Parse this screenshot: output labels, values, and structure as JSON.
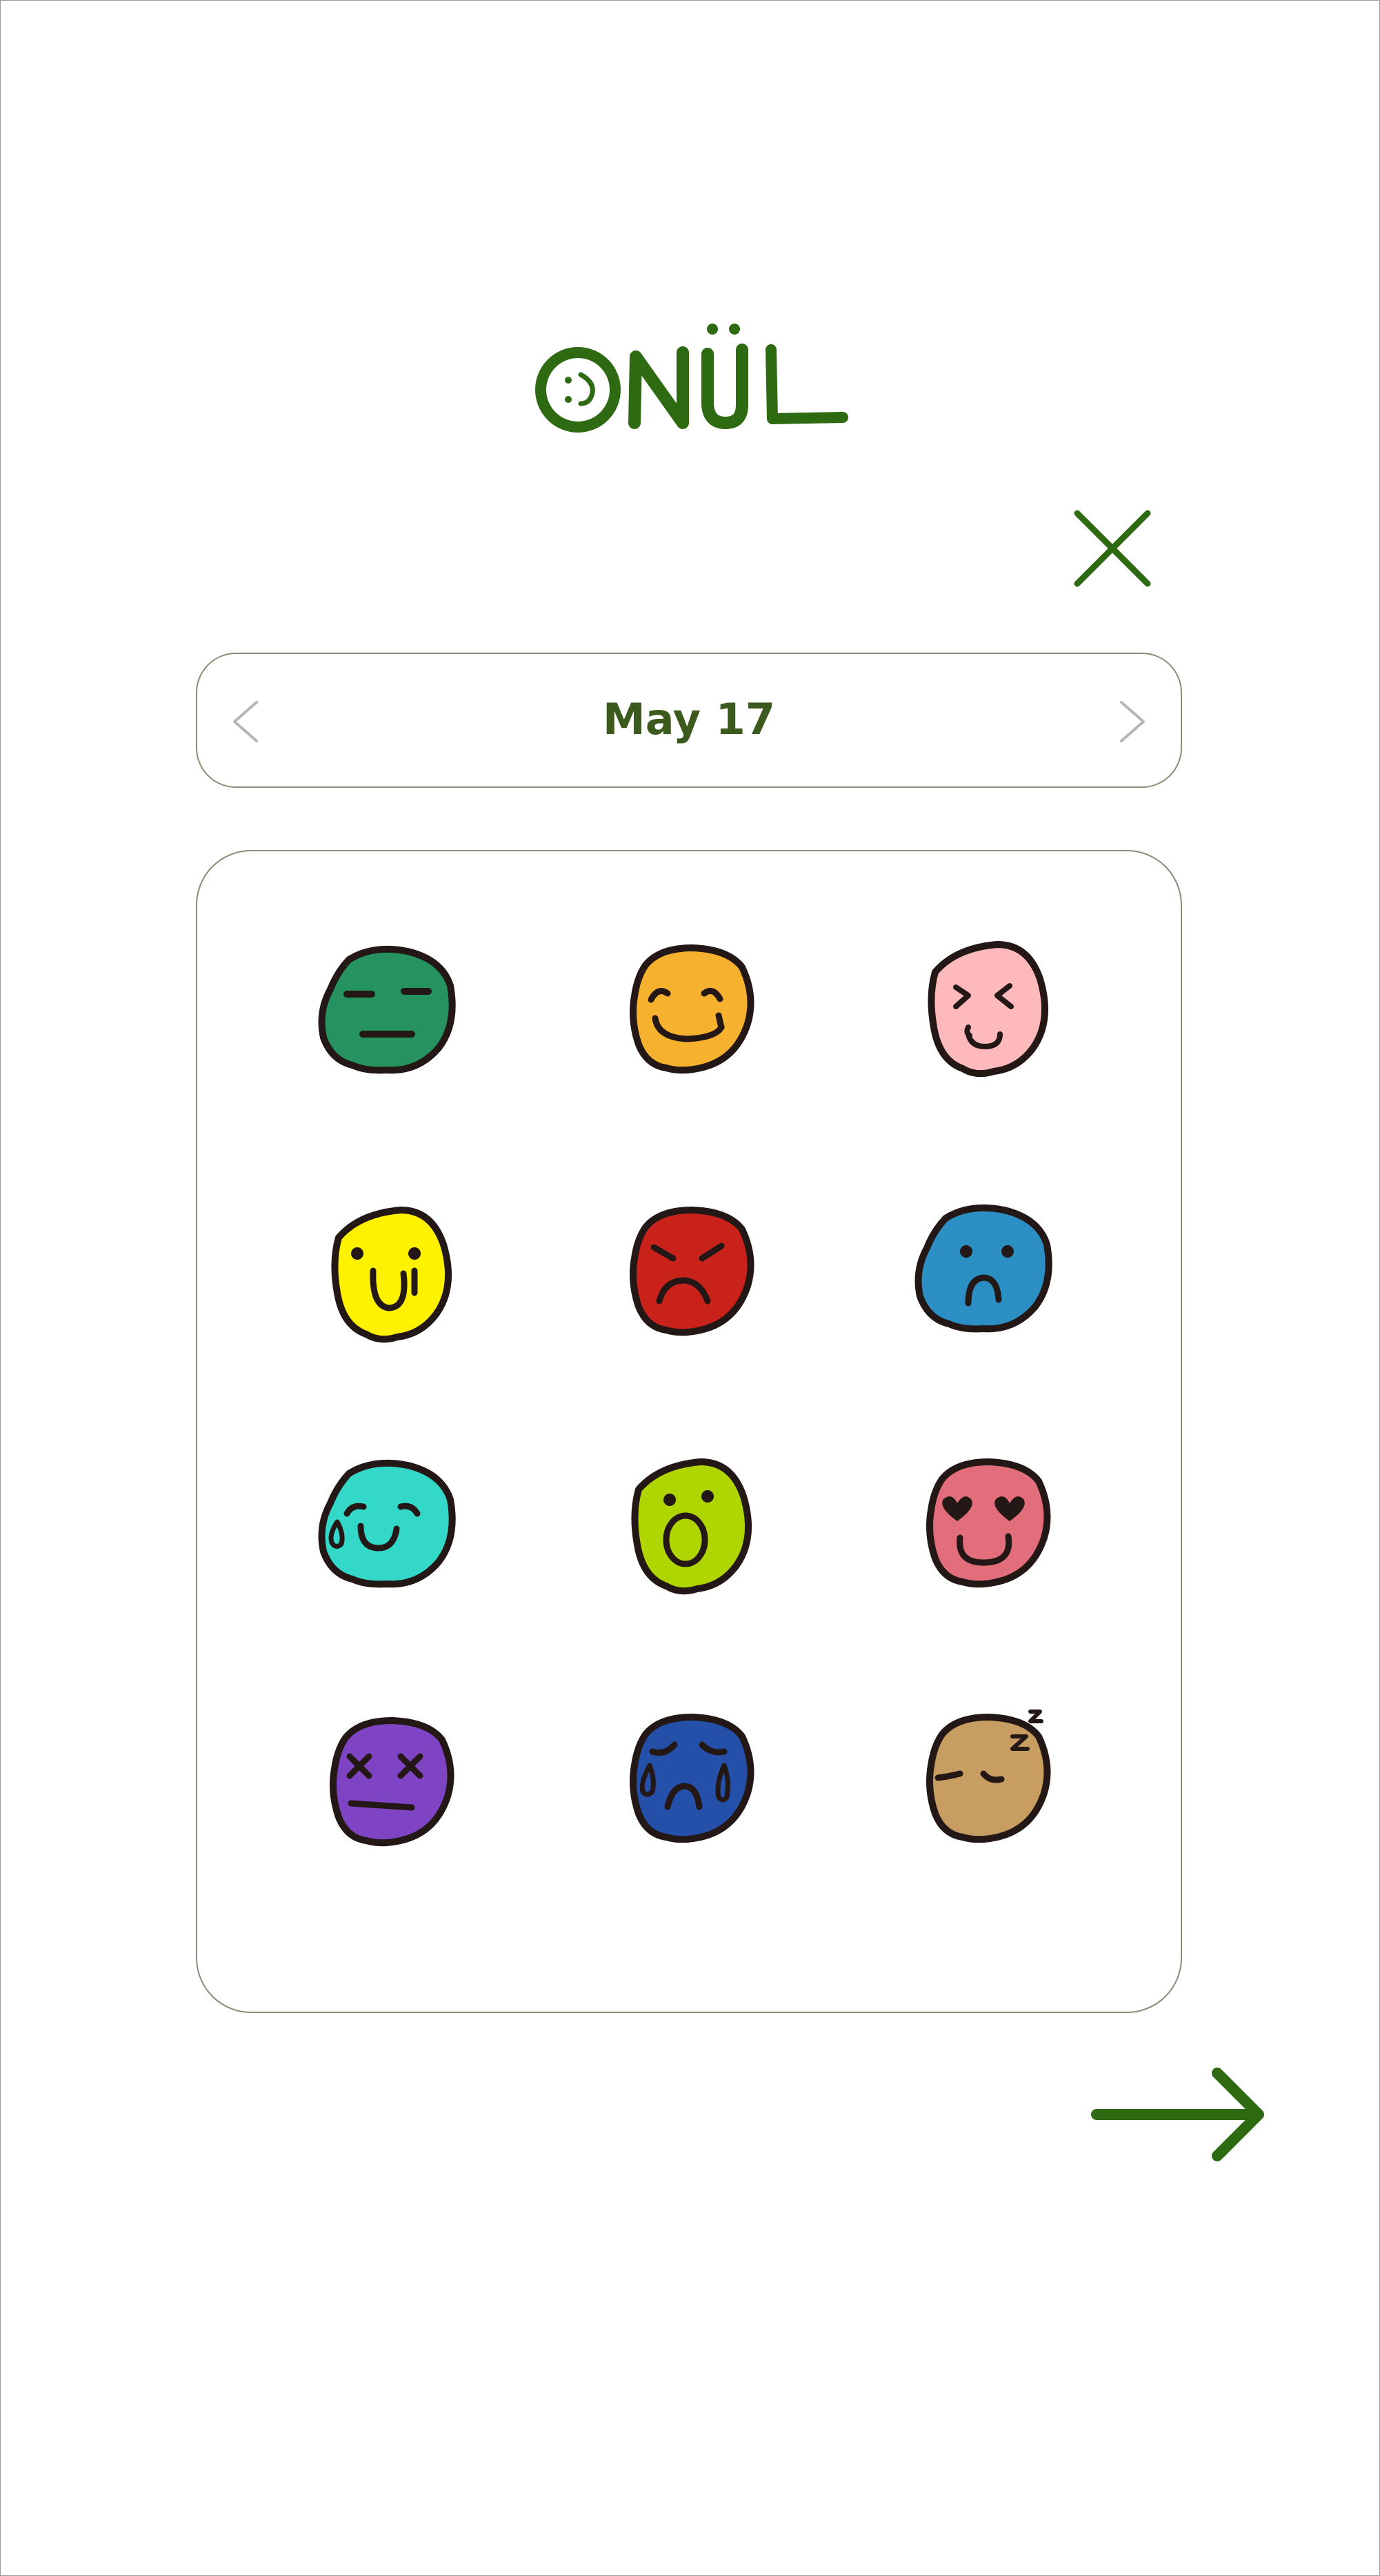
{
  "app": {
    "logo_text": "ONÜL",
    "brand_color": "#2e6a12"
  },
  "header": {
    "close_icon": "close-icon"
  },
  "date_nav": {
    "label": "May 17",
    "prev_icon": "chevron-left-icon",
    "next_icon": "chevron-right-icon"
  },
  "moods": [
    {
      "name": "neutral",
      "color": "#25925f"
    },
    {
      "name": "happy",
      "color": "#f6b22e"
    },
    {
      "name": "excited",
      "color": "#feb9bd"
    },
    {
      "name": "silly",
      "color": "#fff200"
    },
    {
      "name": "angry",
      "color": "#c9221a"
    },
    {
      "name": "sad",
      "color": "#2b8fc4"
    },
    {
      "name": "nervous",
      "color": "#33d8c8"
    },
    {
      "name": "surprised",
      "color": "#afd600"
    },
    {
      "name": "in-love",
      "color": "#e16e7a"
    },
    {
      "name": "dead",
      "color": "#7f44c4"
    },
    {
      "name": "crying",
      "color": "#2550aa"
    },
    {
      "name": "sleepy",
      "color": "#c89d62"
    }
  ],
  "footer": {
    "next_icon": "arrow-right-icon"
  }
}
